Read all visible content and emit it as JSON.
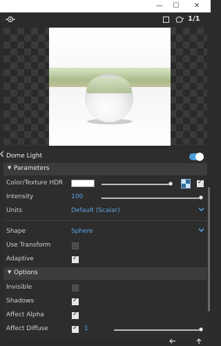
{
  "window": {
    "minimize": "—",
    "maximize": "☐",
    "close": "✕"
  },
  "toolbar": {
    "ratio_label": "1/1"
  },
  "panel": {
    "dome_light": {
      "label": "Dome Light",
      "enabled": true
    },
    "parameters": {
      "title": "Parameters",
      "color_texture": {
        "label": "Color/Texture HDR",
        "color": "#ffffff",
        "level": 1.0,
        "enabled": true
      },
      "intensity": {
        "label": "Intensity",
        "value": "100",
        "level": 1.0
      },
      "units": {
        "label": "Units",
        "value": "Default (Scalar)"
      },
      "shape": {
        "label": "Shape",
        "value": "Sphere"
      },
      "use_transform": {
        "label": "Use Transform",
        "checked": false
      },
      "adaptive": {
        "label": "Adaptive",
        "checked": true
      }
    },
    "options": {
      "title": "Options",
      "invisible": {
        "label": "Invisible",
        "checked": false
      },
      "shadows": {
        "label": "Shadows",
        "checked": true
      },
      "affect_alpha": {
        "label": "Affect Alpha",
        "checked": true
      },
      "affect_diffuse": {
        "label": "Affect Diffuse",
        "checked": true,
        "value": "1",
        "level": 1.0
      }
    }
  },
  "colors": {
    "accent": "#5ba7e6",
    "toggle_on": "#4aa0dd",
    "panel_bg": "#2d2d2d"
  }
}
